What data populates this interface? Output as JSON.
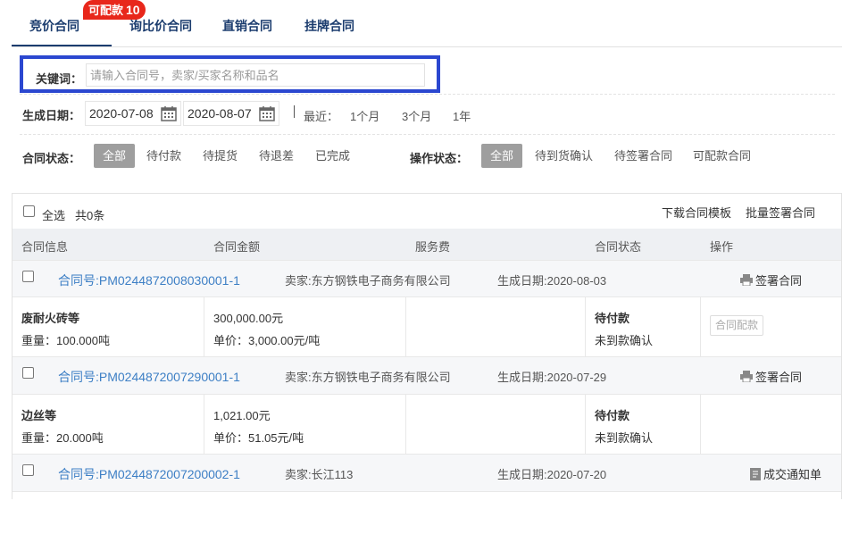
{
  "tabs": [
    {
      "label": "竞价合同",
      "active": true
    },
    {
      "label": "询比价合同",
      "active": false
    },
    {
      "label": "直销合同",
      "active": false
    },
    {
      "label": "挂牌合同",
      "active": false
    }
  ],
  "badge": {
    "label": "可配款",
    "count": "10"
  },
  "keyword": {
    "label": "关键词：",
    "placeholder": "请输入合同号，卖家/买家名称和品名",
    "value": ""
  },
  "date_filter": {
    "label": "生成日期：",
    "start": "2020-07-08",
    "end": "2020-08-07",
    "recent_label": "最近：",
    "recent_options": [
      "1个月",
      "3个月",
      "1年"
    ]
  },
  "contract_status": {
    "label": "合同状态：",
    "options": [
      "全部",
      "待付款",
      "待提货",
      "待退差",
      "已完成"
    ],
    "selected": "全部"
  },
  "operation_status": {
    "label": "操作状态：",
    "options": [
      "全部",
      "待到货确认",
      "待签署合同",
      "可配款合同"
    ],
    "selected": "全部"
  },
  "list": {
    "select_all": "全选",
    "total": "共0条",
    "download_template": "下载合同模板",
    "batch_sign": "批量签署合同",
    "columns": [
      "合同信息",
      "合同金额",
      "服务费",
      "合同状态",
      "操作"
    ]
  },
  "rows": [
    {
      "contract_no": "合同号:PM0244872008030001-1",
      "seller": "卖家:东方钢铁电子商务有限公司",
      "date": "生成日期:2020-08-03",
      "action": "签署合同",
      "action_icon": "printer-icon",
      "product": "废耐火砖等",
      "weight": "重量：100.000吨",
      "amount": "300,000.00元",
      "unit_price": "单价：3,000.00元/吨",
      "status": "待付款",
      "status_sub": "未到款确认",
      "op_button": "合同配款"
    },
    {
      "contract_no": "合同号:PM0244872007290001-1",
      "seller": "卖家:东方钢铁电子商务有限公司",
      "date": "生成日期:2020-07-29",
      "action": "签署合同",
      "action_icon": "printer-icon",
      "product": "边丝等",
      "weight": "重量：20.000吨",
      "amount": "1,021.00元",
      "unit_price": "单价：51.05元/吨",
      "status": "待付款",
      "status_sub": "未到款确认",
      "op_button": ""
    },
    {
      "contract_no": "合同号:PM0244872007200002-1",
      "seller": "卖家:长江113",
      "date": "生成日期:2020-07-20",
      "action": "成交通知单",
      "action_icon": "document-icon"
    }
  ],
  "colors": {
    "accent_blue": "#1b3c6e",
    "link_blue": "#3d7fc5",
    "badge_red": "#e8271b",
    "highlight_border": "#2b47d0"
  }
}
